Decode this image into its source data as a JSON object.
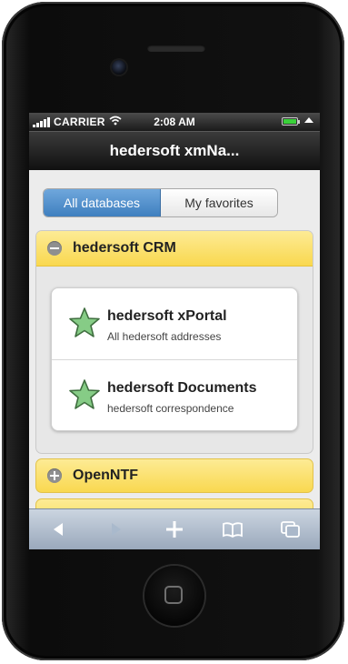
{
  "status": {
    "carrier": "CARRIER",
    "time": "2:08 AM"
  },
  "header": {
    "title": "hedersoft xmNa..."
  },
  "tabs": [
    {
      "label": "All databases",
      "active": true
    },
    {
      "label": "My favorites",
      "active": false
    }
  ],
  "sections": [
    {
      "title": "hedersoft CRM",
      "expanded": true,
      "items": [
        {
          "title": "hedersoft xPortal",
          "subtitle": "All hedersoft addresses",
          "icon": "star-icon"
        },
        {
          "title": "hedersoft Documents",
          "subtitle": "hedersoft correspondence",
          "icon": "star-icon"
        }
      ]
    },
    {
      "title": "OpenNTF",
      "expanded": false
    }
  ],
  "toolbar": {
    "buttons": [
      "back-icon",
      "forward-icon",
      "add-icon",
      "bookmarks-icon",
      "pages-icon"
    ]
  },
  "colors": {
    "accent": "#4a8bd0",
    "accordion": "#fbe37a",
    "star": "#7fc97f"
  }
}
